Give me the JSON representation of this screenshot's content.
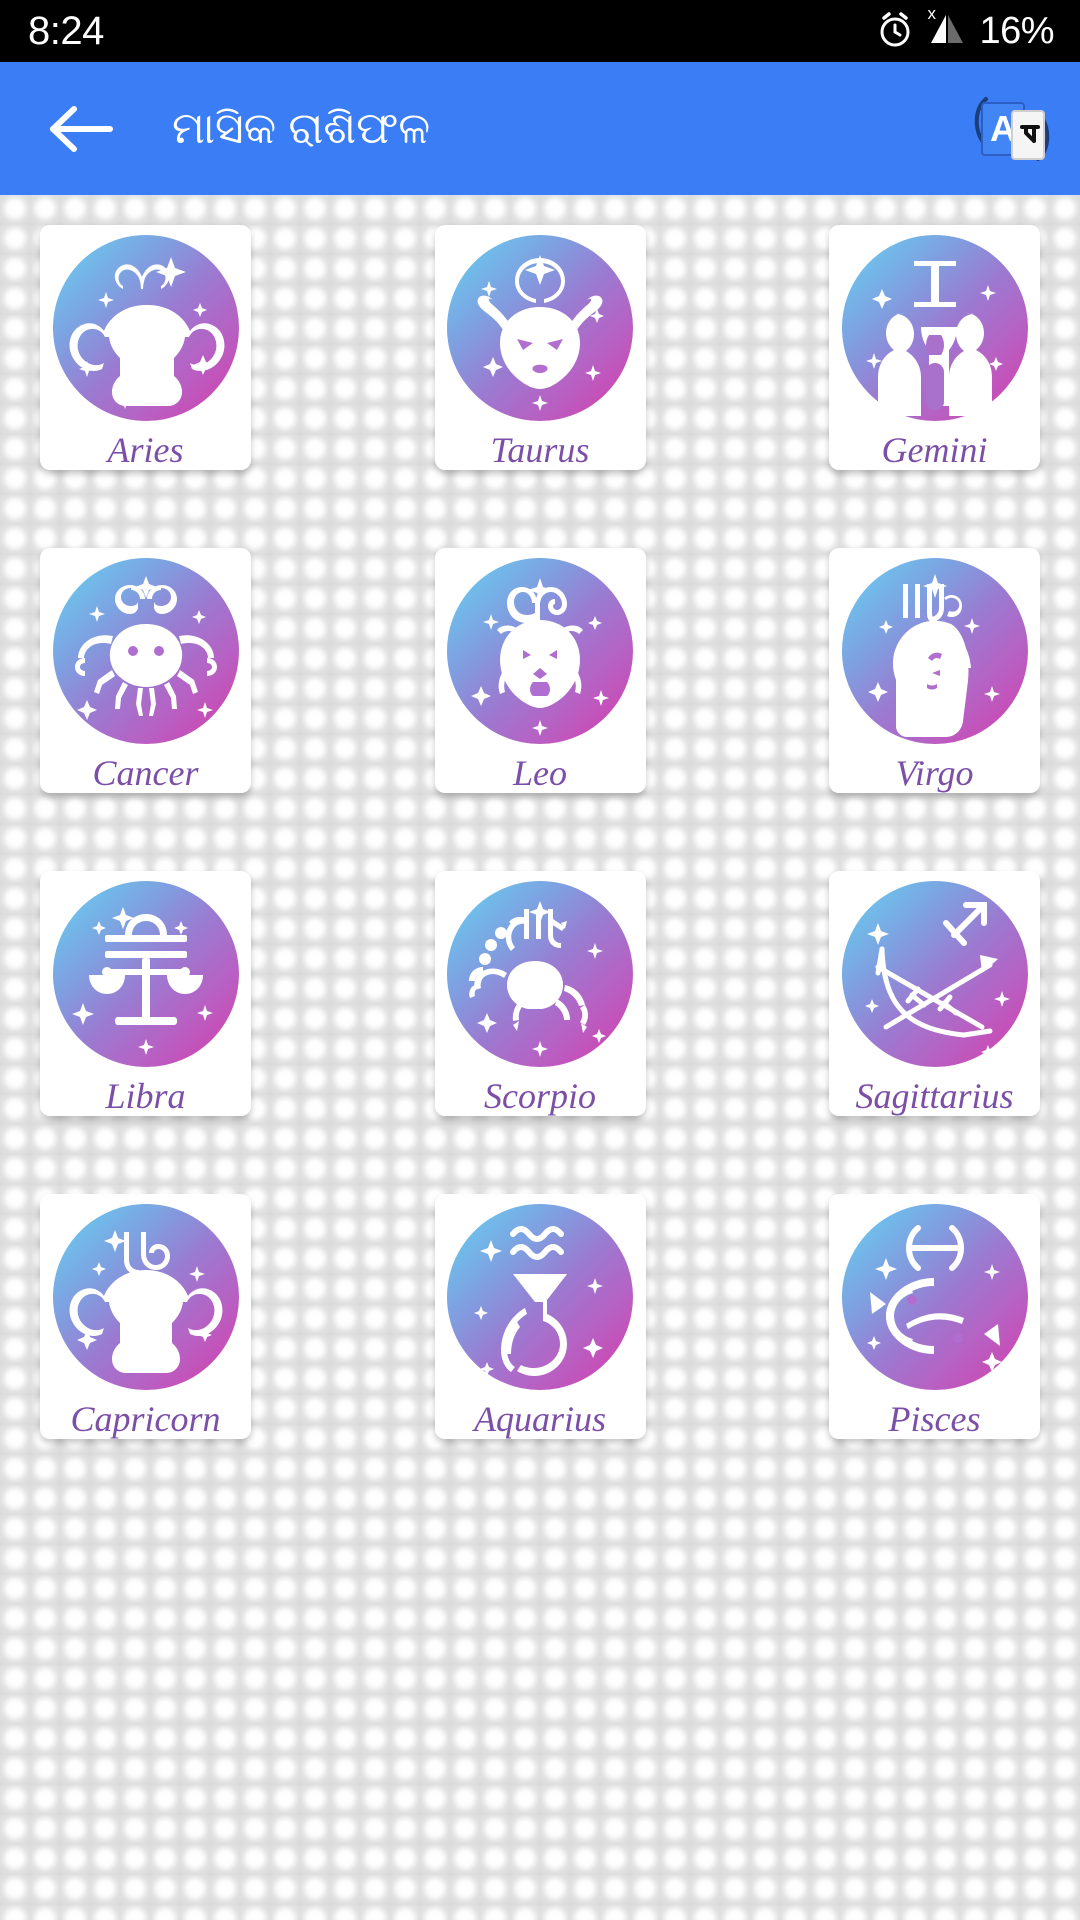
{
  "status_bar": {
    "time": "8:24",
    "battery": "16%",
    "icons": [
      "alarm-icon",
      "signal-icon"
    ],
    "signal_badge": "x",
    "background_color": "#000000",
    "text_color": "#ffffff"
  },
  "app_bar": {
    "title": "ମାସିକ ରାଶିଫଳ",
    "back_label": "Back",
    "translate_label": "Translate",
    "background_color": "#3b7df5",
    "text_color": "#ffffff"
  },
  "theme": {
    "label_color": "#7b4fa8",
    "disc_gradient_start": "#63c8ec",
    "disc_gradient_end": "#cd43ae",
    "card_background": "#ffffff",
    "page_background": "#e9e9e9"
  },
  "grid": {
    "columns": 3,
    "items": [
      {
        "label": "Aries",
        "symbol": "aries-symbol",
        "icon": "ram-icon"
      },
      {
        "label": "Taurus",
        "symbol": "taurus-symbol",
        "icon": "bull-icon"
      },
      {
        "label": "Gemini",
        "symbol": "gemini-symbol",
        "icon": "twins-icon"
      },
      {
        "label": "Cancer",
        "symbol": "cancer-symbol",
        "icon": "crab-icon"
      },
      {
        "label": "Leo",
        "symbol": "leo-symbol",
        "icon": "lion-icon"
      },
      {
        "label": "Virgo",
        "symbol": "virgo-symbol",
        "icon": "maiden-icon"
      },
      {
        "label": "Libra",
        "symbol": "libra-symbol",
        "icon": "scales-icon"
      },
      {
        "label": "Scorpio",
        "symbol": "scorpio-symbol",
        "icon": "scorpion-icon"
      },
      {
        "label": "Sagittarius",
        "symbol": "sagittarius-symbol",
        "icon": "bow-arrow-icon"
      },
      {
        "label": "Capricorn",
        "symbol": "capricorn-symbol",
        "icon": "goat-icon"
      },
      {
        "label": "Aquarius",
        "symbol": "aquarius-symbol",
        "icon": "water-bearer-icon"
      },
      {
        "label": "Pisces",
        "symbol": "pisces-symbol",
        "icon": "fish-icon"
      }
    ]
  }
}
